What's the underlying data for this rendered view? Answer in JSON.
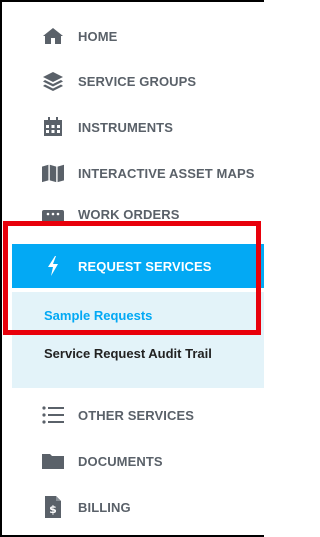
{
  "nav": {
    "home": "HOME",
    "service_groups": "SERVICE GROUPS",
    "instruments": "INSTRUMENTS",
    "interactive_maps": "INTERACTIVE ASSET MAPS",
    "work_orders": "WORK ORDERS",
    "request_services": "REQUEST SERVICES",
    "other_services": "OTHER SERVICES",
    "documents": "DOCUMENTS",
    "billing": "BILLING"
  },
  "submenu": {
    "sample_requests": "Sample Requests",
    "audit_trail": "Service Request Audit Trail"
  },
  "colors": {
    "accent": "#03a9f4",
    "icon_gray": "#5a6169",
    "submenu_bg": "#e3f3f9",
    "highlight": "#e8000b"
  }
}
